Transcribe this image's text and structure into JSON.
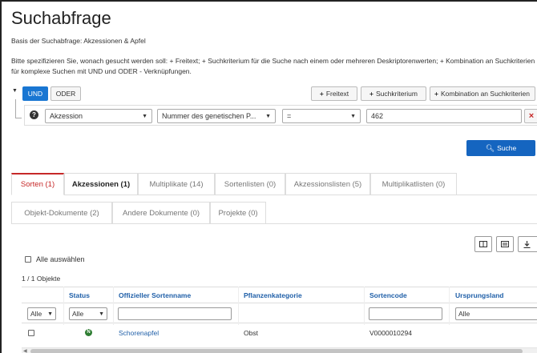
{
  "header": {
    "title": "Suchabfrage",
    "basis": "Basis der Suchabfrage: Akzessionen & Apfel",
    "description": "Bitte spezifizieren Sie, wonach gesucht werden soll: + Freitext; + Suchkriterium für die Suche nach einem oder mehreren Deskriptorenwerten; + Kombination an Suchkriterien für komplexe Suchen mit UND und ODER - Verknüpfungen."
  },
  "query": {
    "und_label": "UND",
    "oder_label": "ODER",
    "freitext_label": "Freitext",
    "suchkriterium_label": "Suchkriterium",
    "kombination_label": "Kombination an Suchkriterien",
    "criterion": {
      "field": "Akzession",
      "descriptor": "Nummer des genetischen P...",
      "operator": "=",
      "value": "462"
    },
    "search_label": "Suche"
  },
  "tabs_row1": [
    {
      "label": "Sorten (1)"
    },
    {
      "label": "Akzessionen (1)"
    },
    {
      "label": "Multiplikate (14)"
    },
    {
      "label": "Sortenlisten (0)"
    },
    {
      "label": "Akzessionslisten (5)"
    },
    {
      "label": "Multiplikatlisten (0)"
    }
  ],
  "tabs_row2": [
    {
      "label": "Objekt-Dokumente (2)"
    },
    {
      "label": "Andere Dokumente (0)"
    },
    {
      "label": "Projekte (0)"
    }
  ],
  "table": {
    "select_all": "Alle auswählen",
    "count": "1 / 1 Objekte",
    "headers": [
      "Status",
      "Offizieller Sortenname",
      "Pflanzenkategorie",
      "Sortencode",
      "Ursprungsland"
    ],
    "filter_all": "Alle",
    "row": {
      "name": "Schorenapfel",
      "category": "Obst",
      "code": "V0000010294"
    }
  },
  "colors": {
    "accent": "#1565c0",
    "active_tab": "#c62828",
    "status_ok": "#2e7d32"
  }
}
